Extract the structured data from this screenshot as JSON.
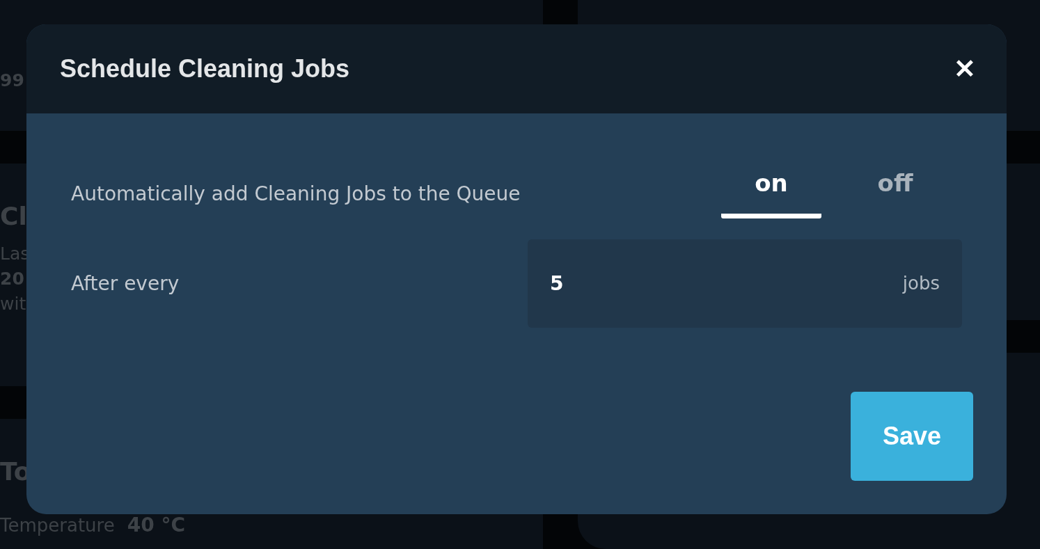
{
  "background": {
    "cards": [
      {
        "lines": [
          {
            "text": "99",
            "bold": true
          }
        ]
      },
      {
        "title": "Cl",
        "lines": [
          {
            "text": "Las",
            "bold": false
          },
          {
            "text": "20",
            "bold": true
          },
          {
            "text": "wit",
            "bold": false
          }
        ]
      },
      {
        "title": "To"
      }
    ],
    "reading": {
      "label": "Temperature",
      "value": "40 °C"
    }
  },
  "dialog": {
    "title": "Schedule Cleaning Jobs",
    "close": "✕",
    "toggle": {
      "label": "Automatically add Cleaning Jobs to the Queue",
      "options": [
        {
          "label": "on",
          "selected": true
        },
        {
          "label": "off",
          "selected": false
        }
      ]
    },
    "interval": {
      "label": "After every",
      "value": "5",
      "unit": "jobs"
    },
    "save": "Save"
  }
}
